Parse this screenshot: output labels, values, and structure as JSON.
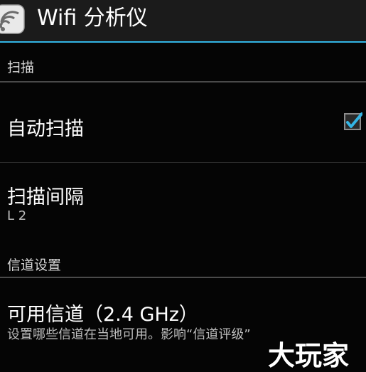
{
  "app": {
    "title": "Wifi 分析仪",
    "icon": "wifi-analyzer-icon"
  },
  "sections": [
    {
      "header": "扫描",
      "items": [
        {
          "title": "自动扫描",
          "checked": true
        },
        {
          "title": "扫描间隔",
          "summary": "L 2"
        }
      ]
    },
    {
      "header": "信道设置",
      "items": [
        {
          "title": "可用信道（2.4 GHz）",
          "summary": "设置哪些信道在当地可用。影响“信道评级”"
        }
      ]
    }
  ],
  "watermark": "大玩家",
  "colors": {
    "accent": "#33b5e5",
    "background": "#000000",
    "action_bar": "#1b1b1b"
  }
}
